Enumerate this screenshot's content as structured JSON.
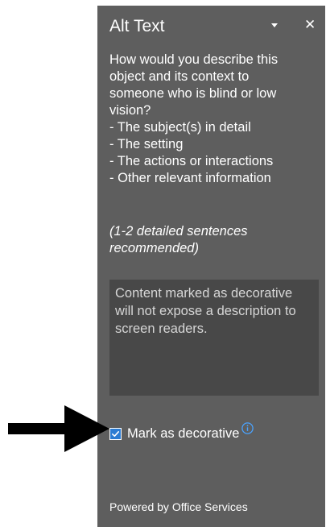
{
  "pane": {
    "title": "Alt Text",
    "description_lines": [
      "How would you describe this",
      "object and its context to",
      "someone who is blind or low",
      "vision?",
      "- The subject(s) in detail",
      "- The setting",
      "- The actions or interactions",
      "- Other relevant information"
    ],
    "hint_lines": [
      "(1-2 detailed sentences",
      "recommended)"
    ],
    "textarea_placeholder": "Content marked as decorative will not expose a description to screen readers.",
    "decorative_checkbox": {
      "label": "Mark as decorative",
      "checked": true
    },
    "footer": "Powered by Office Services"
  },
  "icons": {
    "dropdown": "chevron-down-icon",
    "close": "close-icon",
    "info": "info-icon",
    "checkmark": "checkmark-icon",
    "annotation_arrow": "arrow-right-icon"
  },
  "colors": {
    "panel_bg": "#5e5e5e",
    "textarea_bg": "#484848",
    "accent_blue": "#2b7cd3",
    "info_blue": "#4aa3ff",
    "arrow": "#000000"
  }
}
